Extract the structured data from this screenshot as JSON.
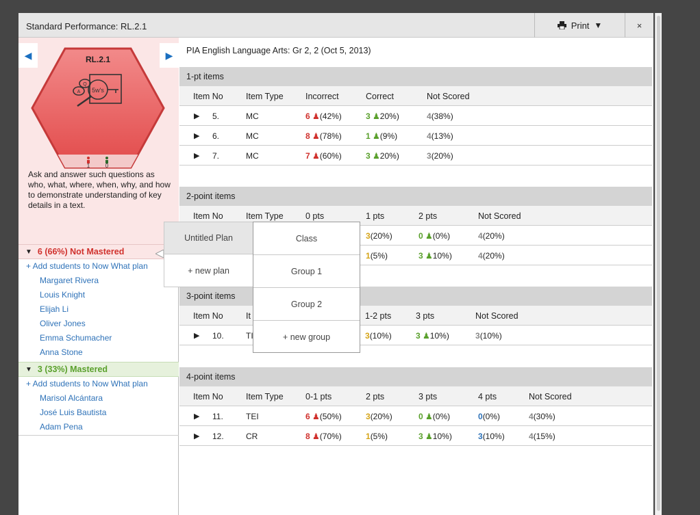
{
  "window": {
    "title": "Standard Performance: RL.2.1",
    "print_label": "Print",
    "print_caret": "▼",
    "close_label": "×"
  },
  "standard": {
    "code": "RL.2.1",
    "hex_icon_text": "5w's",
    "mastered_not": "1",
    "mastered_yes": "0",
    "description": "Ask and answer such questions as who, what, where, when, why, and how to demonstrate understanding of key details in a text."
  },
  "groups": {
    "not_mastered": {
      "label": "6 (66%) Not Mastered",
      "add": "+ Add students to Now What plan",
      "students": [
        "Margaret Rivera",
        "Louis Knight",
        "Elijah Li",
        "Oliver Jones",
        "Emma Schumacher",
        "Anna Stone"
      ]
    },
    "mastered": {
      "label": "3 (33%) Mastered",
      "add": "+ Add students to Now What plan",
      "students": [
        "Marisol Alcántara",
        "José Luis Bautista",
        "Adam Pena"
      ]
    }
  },
  "assessment_title": "PIA English Language Arts: Gr 2, 2 (Oct 5, 2013)",
  "sections": {
    "one": {
      "title": "1-pt items",
      "headers": [
        "Item No",
        "Item Type",
        "Incorrect",
        "Correct",
        "Not Scored"
      ],
      "rows": [
        {
          "no": "5.",
          "type": "MC",
          "inc_n": "6",
          "inc_p": "(42%)",
          "cor_n": "3",
          "cor_p": "20%)",
          "ns_n": "4",
          "ns_p": "(38%)"
        },
        {
          "no": "6.",
          "type": "MC",
          "inc_n": "8",
          "inc_p": "(78%)",
          "cor_n": "1",
          "cor_p": "(9%)",
          "ns_n": "4",
          "ns_p": "(13%)"
        },
        {
          "no": "7.",
          "type": "MC",
          "inc_n": "7",
          "inc_p": "(60%)",
          "cor_n": "3",
          "cor_p": "20%)",
          "ns_n": "3",
          "ns_p": "(20%)"
        }
      ]
    },
    "two": {
      "title": "2-point items",
      "headers": [
        "Item No",
        "Item Type",
        "0 pts",
        "1 pts",
        "2 pts",
        "Not Scored"
      ],
      "rows": [
        {
          "p1_n": "3",
          "p1_p": "(20%)",
          "p2_n": "0",
          "p2_p": "(0%)",
          "ns_n": "4",
          "ns_p": "(20%)"
        },
        {
          "p1_n": "1",
          "p1_p": "(5%)",
          "p2_n": "3",
          "p2_p": "10%)",
          "ns_n": "4",
          "ns_p": "(20%)"
        }
      ]
    },
    "three": {
      "title": "3-point items",
      "headers": [
        "Item No",
        "It",
        "1-2 pts",
        "3 pts",
        "Not Scored"
      ],
      "rows": [
        {
          "no": "10.",
          "type": "TI",
          "p12_n": "3",
          "p12_p": "(10%)",
          "p3_n": "3",
          "p3_p": "10%)",
          "ns_n": "3",
          "ns_p": "(10%)"
        }
      ]
    },
    "four": {
      "title": "4-point items",
      "headers": [
        "Item No",
        "Item Type",
        "0-1 pts",
        "2 pts",
        "3 pts",
        "4 pts",
        "Not Scored"
      ],
      "rows": [
        {
          "no": "11.",
          "type": "TEI",
          "p01_n": "6",
          "p01_p": "(50%)",
          "p2_n": "3",
          "p2_p": "(20%)",
          "p3_n": "0",
          "p3_p": "(0%)",
          "p4_n": "0",
          "p4_p": "(0%)",
          "ns_n": "4",
          "ns_p": "(30%)"
        },
        {
          "no": "12.",
          "type": "CR",
          "p01_n": "8",
          "p01_p": "(70%)",
          "p2_n": "1",
          "p2_p": "(5%)",
          "p3_n": "3",
          "p3_p": "10%)",
          "p4_n": "3",
          "p4_p": "(10%)",
          "ns_n": "4",
          "ns_p": "(15%)"
        }
      ]
    }
  },
  "popup": {
    "plans": [
      "Untitled Plan",
      "+ new plan"
    ],
    "groups": [
      "Class",
      "Group 1",
      "Group 2",
      "+ new group"
    ]
  },
  "icons": {
    "play": "▶",
    "collapse": "▼",
    "prev": "◀",
    "next": "▶"
  },
  "colors": {
    "red": "#d0312d",
    "green": "#5aa02c",
    "yellow": "#d5a418",
    "blue": "#2e72b8",
    "grey": "#888888"
  }
}
